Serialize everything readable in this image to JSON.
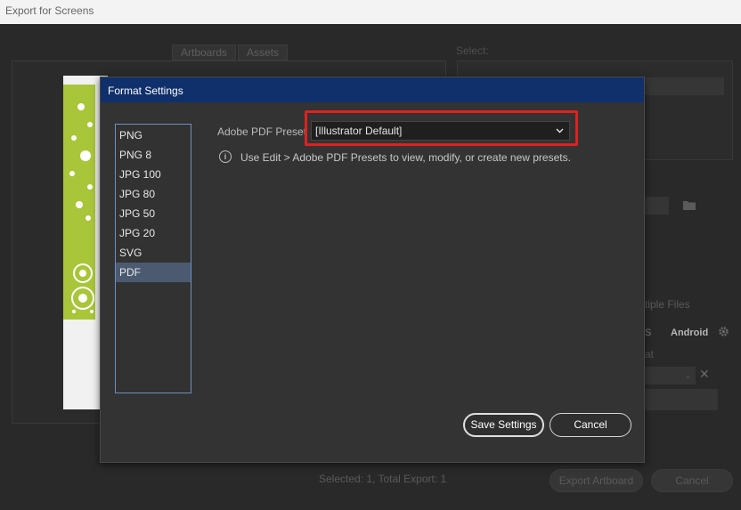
{
  "window": {
    "title": "Export for Screens"
  },
  "background": {
    "tabs": [
      "Artboards",
      "Assets"
    ],
    "select_label": "Select:",
    "multiple_files_label": "tiple Files",
    "platform_left": "S",
    "platform_android": "Android",
    "format_label": "at",
    "status": "Selected: 1, Total Export: 1",
    "export_button": "Export Artboard",
    "cancel_button": "Cancel"
  },
  "dialog": {
    "title": "Format Settings",
    "formats": [
      "PNG",
      "PNG 8",
      "JPG 100",
      "JPG 80",
      "JPG 50",
      "JPG 20",
      "SVG",
      "PDF"
    ],
    "selected_format": "PDF",
    "preset_label": "Adobe PDF Preset",
    "preset_value": "[Illustrator Default]",
    "info_text": "Use Edit > Adobe PDF Presets to view, modify, or create new presets.",
    "save_button": "Save Settings",
    "cancel_button": "Cancel"
  },
  "colors": {
    "dialog_title_bar": "#10306b",
    "highlight_box": "#e02020",
    "list_border": "#6e8fbf",
    "selected_item": "#4b5a70"
  },
  "icons": {
    "dropdown": "chevron-down-icon",
    "info": "info-icon",
    "folder": "folder-icon",
    "gear": "gear-icon",
    "close": "close-icon"
  }
}
